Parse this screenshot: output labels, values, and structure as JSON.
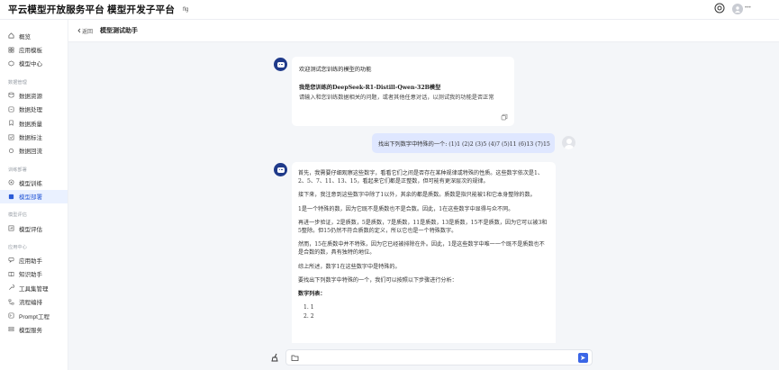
{
  "header": {
    "title": "平云模型开放服务平台 模型开发子平台",
    "tag": "flg",
    "username": "•••"
  },
  "sidebar": {
    "items": [
      {
        "label": "概览",
        "icon": "home-icon"
      },
      {
        "label": "应用模板",
        "icon": "grid-icon"
      },
      {
        "label": "模型中心",
        "icon": "cube-icon"
      }
    ],
    "groups": [
      {
        "title": "数据管理",
        "items": [
          {
            "label": "数据资源",
            "icon": "database-icon"
          },
          {
            "label": "数据处理",
            "icon": "process-icon"
          },
          {
            "label": "数据质量",
            "icon": "bookmark-icon"
          },
          {
            "label": "数据标注",
            "icon": "tag-icon"
          },
          {
            "label": "数据回流",
            "icon": "reflow-icon"
          }
        ]
      },
      {
        "title": "训练部署",
        "items": [
          {
            "label": "模型训练",
            "icon": "train-icon"
          },
          {
            "label": "模型部署",
            "icon": "deploy-icon",
            "active": true
          }
        ]
      },
      {
        "title": "模型评估",
        "items": [
          {
            "label": "模型评估",
            "icon": "evaluate-icon"
          }
        ]
      },
      {
        "title": "应用中心",
        "items": [
          {
            "label": "应用助手",
            "icon": "assistant-icon"
          },
          {
            "label": "知识助手",
            "icon": "knowledge-icon"
          },
          {
            "label": "工具集管理",
            "icon": "tools-icon"
          },
          {
            "label": "流程编排",
            "icon": "flow-icon"
          },
          {
            "label": "Prompt工程",
            "icon": "prompt-icon"
          },
          {
            "label": "模型服务",
            "icon": "service-icon"
          }
        ]
      }
    ]
  },
  "breadcrumb": {
    "back_label": "返回",
    "title": "模型测试助手"
  },
  "chat": {
    "welcome": {
      "title": "欢迎测试您训练的模型的功能",
      "model_line": "我是您训练的DeepSeek-R1-Distill-Qwen-32B模型",
      "hint": "请输入和您训练数据相关的问题，或者其他任意对话，以测试我的功能是否正常"
    },
    "user_message": "找出下列数字中特殊的一个: (1)1 (2)2 (3)5 (4)7 (5)11 (6)13 (7)15",
    "answer": {
      "p1": "首先，我需要仔细观察这些数字，看看它们之间是否存在某种规律或特殊的性质。这些数字依次是1、2、5、7、11、13、15，看起来它们都是正整数，但可能有更深层次的规律。",
      "p2": "接下来，我注意到这些数字中除了1以外，其余的都是质数。质数是指只能被1和它本身整除的数。",
      "p3": "1是一个特殊的数，因为它既不是质数也不是合数。因此，1在这些数字中显得与众不同。",
      "p4": "再进一步验证，2是质数，5是质数，7是质数，11是质数，13是质数，15不是质数，因为它可以被3和5整除。但15仍然不符合质数的定义，所以它也是一个特殊数字。",
      "p5": "然而，15在质数中并不特殊，因为它已经被排除在外。因此，1是这些数字中唯一一个既不是质数也不是合数的数，具有独特的地位。",
      "p6": "综上所述，数字1在这些数字中是特殊的。",
      "p7": "要找出下列数字中特殊的一个，我们可以按照以下步骤进行分析：",
      "list_title": "数字列表：",
      "list": [
        "1. 1",
        "2. 2"
      ]
    }
  },
  "input": {
    "placeholder": ""
  }
}
